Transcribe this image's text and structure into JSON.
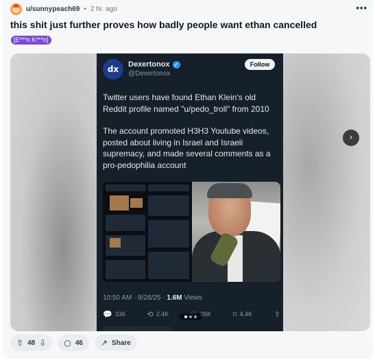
{
  "post": {
    "username": "u/sunnypeach69",
    "separator": "•",
    "time": "2 hr. ago",
    "more_label": "•••",
    "title": "this shit just further proves how badly people want ethan cancelled",
    "flair": "[E***n K***n]"
  },
  "tweet": {
    "display_name": "Dexertonox",
    "handle": "@Dexertonox",
    "avatar_text": "dx",
    "follow_label": "Follow",
    "paragraph_1": "Twitter users have found Ethan Klein's old Reddit profile named \"u/pedo_troll\" from 2010",
    "paragraph_2": "The account promoted H3H3 Youtube videos, posted about living in Israel and Israeli supremacy, and made several comments as a pro-pedophilia account",
    "timestamp": "10:50 AM · 8/28/25 · ",
    "views_count": "1.6M",
    "views_label": " Views",
    "replies": "336",
    "retweets": "2.4K",
    "likes": "26K",
    "bookmarks": "4.4K"
  },
  "icons": {
    "reply": "💬",
    "retweet": "⟲",
    "like": "♡",
    "bookmark": "⌑",
    "share": "⇪",
    "next": "›",
    "upvote": "⇧",
    "downvote": "⇩",
    "comment": "○",
    "share_post": "↗"
  },
  "actions": {
    "votes": "48",
    "comments": "46",
    "share_label": "Share"
  },
  "colors": {
    "flair": "#7a4bd6",
    "tweet_bg": "#15202b",
    "verified": "#1d9bf0"
  }
}
